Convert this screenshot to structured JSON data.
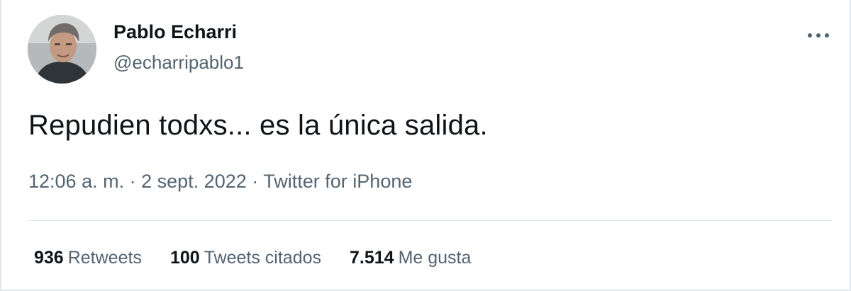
{
  "author": {
    "name": "Pablo Echarri",
    "handle": "@echarripablo1",
    "avatar_icon": "profile-photo"
  },
  "more_icon": "more-horizontal-icon",
  "tweet": {
    "text": "Repudien todxs... es la única salida."
  },
  "meta": {
    "time": "12:06 a. m.",
    "separator": "·",
    "date": "2 sept. 2022",
    "source": "Twitter for iPhone"
  },
  "stats": [
    {
      "count": "936",
      "label": "Retweets"
    },
    {
      "count": "100",
      "label": "Tweets citados"
    },
    {
      "count": "7.514",
      "label": "Me gusta"
    }
  ],
  "colors": {
    "text_primary": "#0f1419",
    "text_secondary": "#536471",
    "border": "#e1e8ed"
  }
}
